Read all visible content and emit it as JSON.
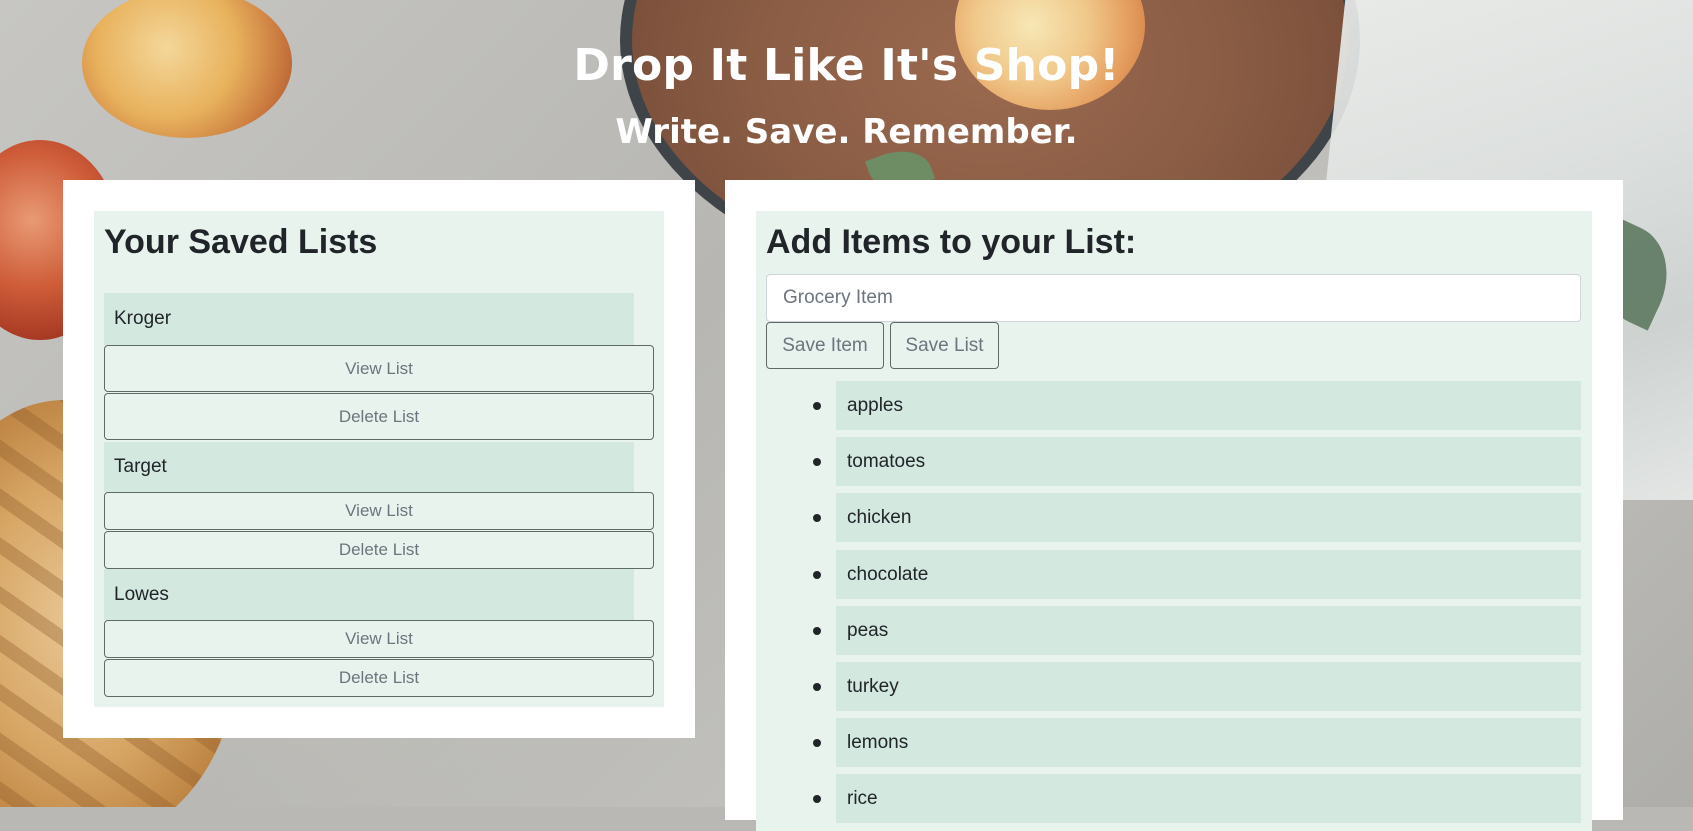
{
  "header": {
    "title": "Drop It Like It's Shop!",
    "subtitle": "Write. Save. Remember."
  },
  "saved_lists": {
    "heading": "Your Saved Lists",
    "lists": [
      {
        "name": "Kroger",
        "view_label": "View List",
        "delete_label": "Delete List"
      },
      {
        "name": "Target",
        "view_label": "View List",
        "delete_label": "Delete List"
      },
      {
        "name": "Lowes",
        "view_label": "View List",
        "delete_label": "Delete List"
      }
    ]
  },
  "add_items": {
    "heading": "Add Items to your List:",
    "input_placeholder": "Grocery Item",
    "input_value": "",
    "save_item_label": "Save Item",
    "save_list_label": "Save List",
    "items": [
      "apples",
      "tomatoes",
      "chicken",
      "chocolate",
      "peas",
      "turkey",
      "lemons",
      "rice"
    ]
  },
  "colors": {
    "panel_inner": "#e8f3ee",
    "row_fill": "#d3e8df",
    "button_text": "#6c757d",
    "heading_text": "#212529"
  }
}
